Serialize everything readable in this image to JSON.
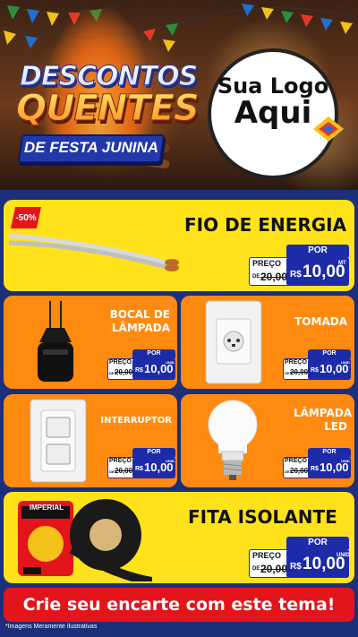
{
  "hero": {
    "title_line1": "DESCONTOS",
    "title_line2": "QUENTES",
    "subtitle": "DE FESTA JUNINA",
    "logo_line1": "Sua Logo",
    "logo_line2": "Aqui"
  },
  "products": {
    "fio": {
      "title": "FIO DE ENERGIA",
      "badge": "-50%",
      "por": "POR",
      "preco": "PREÇO",
      "de": "DE",
      "old": "20,00",
      "currency": "R$",
      "price": "10,00",
      "unit": "MT"
    },
    "bocal": {
      "title": "BOCAL DE LÂMPADA",
      "por": "POR",
      "preco": "PREÇO",
      "de": "DE",
      "old": "20,00",
      "currency": "R$",
      "price": "10,00",
      "unit": "UNID"
    },
    "tomada": {
      "title": "TOMADA",
      "por": "POR",
      "preco": "PREÇO",
      "de": "DE",
      "old": "20,00",
      "currency": "R$",
      "price": "10,00",
      "unit": "UNID"
    },
    "interruptor": {
      "title": "INTERRUPTOR",
      "por": "POR",
      "preco": "PREÇO",
      "de": "DE",
      "old": "20,00",
      "currency": "R$",
      "price": "10,00",
      "unit": "UNID"
    },
    "lampada": {
      "title": "LÂMPADA LED",
      "por": "POR",
      "preco": "PREÇO",
      "de": "DE",
      "old": "20,00",
      "currency": "R$",
      "price": "10,00",
      "unit": "UNID"
    },
    "fita": {
      "title": "FITA ISOLANTE",
      "brand": "IMPERIAL",
      "por": "POR",
      "preco": "PREÇO",
      "de": "DE",
      "old": "20,00",
      "currency": "R$",
      "price": "10,00",
      "unit": "UNID"
    }
  },
  "cta": "Crie seu encarte com este tema!",
  "footer": "*Imagens Meramente Ilustrativas",
  "colors": {
    "yellow": "#ffe21a",
    "orange": "#ff8a10",
    "blue": "#1d2ba8",
    "red": "#e4141b",
    "background": "#1b2f7a"
  }
}
